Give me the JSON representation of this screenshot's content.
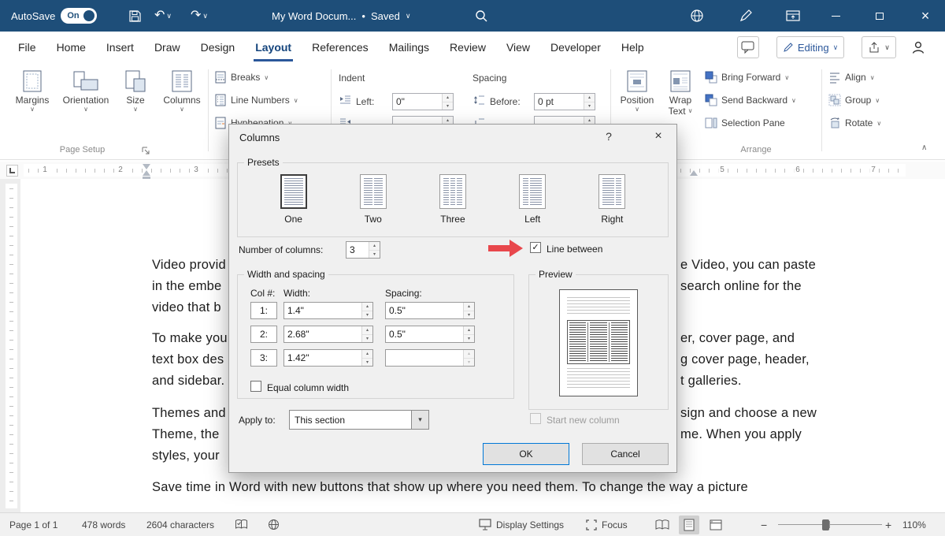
{
  "colors": {
    "titlebar": "#1e4e79",
    "accent": "#2b579a",
    "arrow_red": "#e8474c",
    "default_button_border": "#0078d7"
  },
  "icons": {
    "chevron_down": "∨",
    "chevron_up": "∧",
    "close": "×",
    "undo": "↶",
    "redo": "↷",
    "check": "✓",
    "spin_up": "▴",
    "spin_down": "▾",
    "dropdown": "▾",
    "help": "?",
    "bullet": "•",
    "minus": "−",
    "plus": "+"
  },
  "titlebar": {
    "autosave_label": "AutoSave",
    "autosave_state": "On",
    "doc_title": "My Word Docum...",
    "saved_status": "Saved"
  },
  "tabs": {
    "items": [
      "File",
      "Home",
      "Insert",
      "Draw",
      "Design",
      "Layout",
      "References",
      "Mailings",
      "Review",
      "View",
      "Developer",
      "Help"
    ],
    "active": "Layout",
    "editing_label": "Editing"
  },
  "ribbon": {
    "margins": "Margins",
    "orientation": "Orientation",
    "size": "Size",
    "columns": "Columns",
    "breaks": "Breaks",
    "line_numbers": "Line Numbers",
    "hyphenation": "Hyphenation",
    "indent_label": "Indent",
    "indent_left_label": "Left:",
    "indent_left_value": "0\"",
    "spacing_label": "Spacing",
    "spacing_before_label": "Before:",
    "spacing_before_value": "0 pt",
    "position": "Position",
    "wrap_line1": "Wrap",
    "wrap_line2": "Text",
    "bring_forward": "Bring Forward",
    "send_backward": "Send Backward",
    "selection_pane": "Selection Pane",
    "align": "Align",
    "group": "Group",
    "rotate": "Rotate",
    "page_setup_group": "Page Setup",
    "arrange_group": "Arrange"
  },
  "ruler": {
    "numbers": [
      "1",
      "2",
      "3",
      "5",
      "6",
      "7"
    ]
  },
  "dialog": {
    "title": "Columns",
    "presets_label": "Presets",
    "presets": [
      {
        "label": "One"
      },
      {
        "label": "Two"
      },
      {
        "label": "Three"
      },
      {
        "label": "Left"
      },
      {
        "label": "Right"
      }
    ],
    "number_of_columns_label": "Number of columns:",
    "number_of_columns_value": "3",
    "line_between_label": "Line between",
    "line_between_checked": true,
    "width_and_spacing_label": "Width and spacing",
    "col_header": "Col #:",
    "width_header": "Width:",
    "spacing_header": "Spacing:",
    "rows": [
      {
        "num": "1:",
        "width": "1.4\"",
        "spacing": "0.5\""
      },
      {
        "num": "2:",
        "width": "2.68\"",
        "spacing": "0.5\""
      },
      {
        "num": "3:",
        "width": "1.42\"",
        "spacing": ""
      }
    ],
    "equal_column_width_label": "Equal column width",
    "equal_column_width_checked": false,
    "preview_label": "Preview",
    "start_new_column_label": "Start new column",
    "start_new_column_enabled": false,
    "apply_to_label": "Apply to:",
    "apply_to_value": "This section",
    "ok_label": "OK",
    "cancel_label": "Cancel"
  },
  "document": {
    "left_lines": [
      "Video provid",
      "in the embe",
      "video that b",
      "To make you",
      "text box des",
      "and sidebar.",
      "Themes and",
      "Theme, the",
      "styles, your"
    ],
    "right_lines": [
      "e Video, you can paste",
      "search online for the",
      "er, cover page, and",
      "g cover page, header,",
      "t galleries.",
      "sign and choose a new",
      "me. When you apply"
    ],
    "bottom_line": "Save time in Word with new buttons that show up where you need them. To change the way a picture"
  },
  "statusbar": {
    "page": "Page 1 of 1",
    "words": "478 words",
    "characters": "2604 characters",
    "display_settings": "Display Settings",
    "focus": "Focus",
    "zoom_level": "110%"
  }
}
